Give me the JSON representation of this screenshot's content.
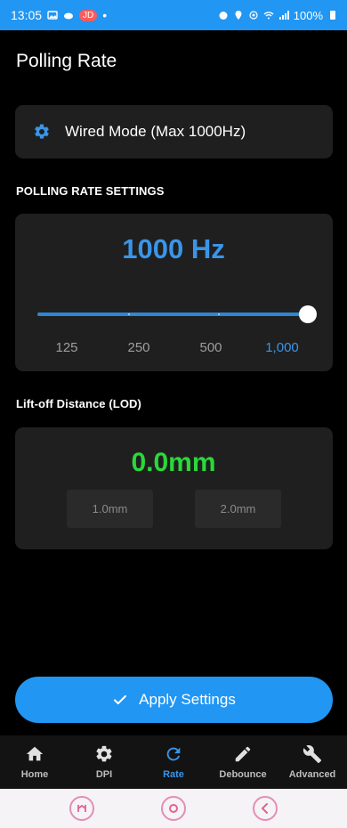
{
  "status_bar": {
    "time": "13:05",
    "notification_badge": "JD",
    "battery": "100%"
  },
  "page": {
    "title": "Polling Rate"
  },
  "mode_card": {
    "label": "Wired Mode (Max 1000Hz)"
  },
  "polling": {
    "section_title": "POLLING RATE SETTINGS",
    "value_text": "1000 Hz",
    "slider_level": 1.0,
    "tick_labels": [
      "125",
      "250",
      "500",
      "1,000"
    ],
    "selected_index": 3
  },
  "lod": {
    "section_title": "Lift-off Distance (LOD)",
    "value_text": "0.0mm",
    "options": [
      "1.0mm",
      "2.0mm"
    ]
  },
  "apply_button": {
    "label": "Apply Settings"
  },
  "bottom_nav": {
    "items": [
      {
        "label": "Home",
        "icon": "home-icon"
      },
      {
        "label": "DPI",
        "icon": "gear-icon"
      },
      {
        "label": "Rate",
        "icon": "refresh-icon"
      },
      {
        "label": "Debounce",
        "icon": "pencil-icon"
      },
      {
        "label": "Advanced",
        "icon": "wrench-icon"
      }
    ],
    "active_index": 2
  },
  "colors": {
    "accent": "#2196f3",
    "hz_text": "#3a95e8",
    "lod_text": "#2bd73a",
    "card_bg": "#1f1f1f"
  }
}
